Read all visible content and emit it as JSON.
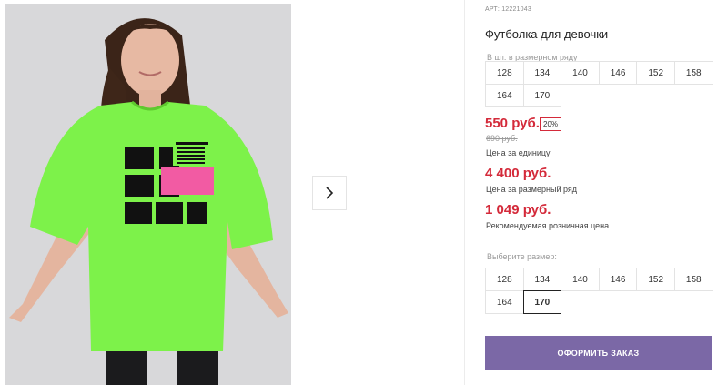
{
  "product": {
    "article": "АРТ: 12221043",
    "title": "Футболка для девочки",
    "shirt_print": {
      "big_letters": [
        "DI",
        "GI",
        "TAL"
      ],
      "small_lines": [
        "DANCE",
        "I'M DANCING",
        "AS FAST",
        "AS I CAN",
        "DIGITAL DANCE",
        "IS MY LIFE"
      ],
      "pink_label": "DIGITAL DANCE"
    }
  },
  "gallery": {
    "next_icon": "chevron-right-icon"
  },
  "sizes_row": {
    "hint": "В шт. в размерном ряду",
    "sizes": [
      "128",
      "134",
      "140",
      "146",
      "152",
      "158",
      "164",
      "170"
    ]
  },
  "pricing": {
    "unit_price": "550 руб.",
    "discount": "20%",
    "old_price": "690 руб.",
    "unit_note": "Цена за единицу",
    "row_price": "4 400 руб.",
    "row_note": "Цена за размерный ряд",
    "retail_price": "1 049 руб.",
    "retail_note": "Рекомендуемая розничная цена"
  },
  "size_select": {
    "label": "Выберите размер:",
    "sizes": [
      "128",
      "134",
      "140",
      "146",
      "152",
      "158",
      "164",
      "170"
    ],
    "selected": "170"
  },
  "order_button": "ОФОРМИТЬ ЗАКАЗ",
  "colors": {
    "price_red": "#d42a3a",
    "button_purple": "#7b68a6",
    "shirt_green": "#7df24a",
    "print_pink": "#f25ba3"
  }
}
